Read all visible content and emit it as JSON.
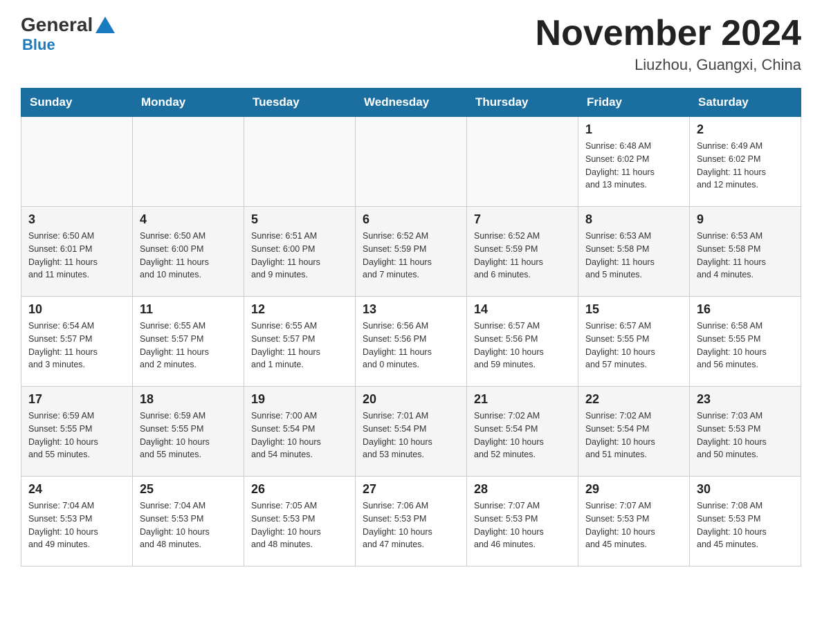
{
  "header": {
    "logo_general": "General",
    "logo_blue": "Blue",
    "month_title": "November 2024",
    "location": "Liuzhou, Guangxi, China"
  },
  "days_of_week": [
    "Sunday",
    "Monday",
    "Tuesday",
    "Wednesday",
    "Thursday",
    "Friday",
    "Saturday"
  ],
  "weeks": [
    [
      {
        "day": "",
        "info": ""
      },
      {
        "day": "",
        "info": ""
      },
      {
        "day": "",
        "info": ""
      },
      {
        "day": "",
        "info": ""
      },
      {
        "day": "",
        "info": ""
      },
      {
        "day": "1",
        "info": "Sunrise: 6:48 AM\nSunset: 6:02 PM\nDaylight: 11 hours\nand 13 minutes."
      },
      {
        "day": "2",
        "info": "Sunrise: 6:49 AM\nSunset: 6:02 PM\nDaylight: 11 hours\nand 12 minutes."
      }
    ],
    [
      {
        "day": "3",
        "info": "Sunrise: 6:50 AM\nSunset: 6:01 PM\nDaylight: 11 hours\nand 11 minutes."
      },
      {
        "day": "4",
        "info": "Sunrise: 6:50 AM\nSunset: 6:00 PM\nDaylight: 11 hours\nand 10 minutes."
      },
      {
        "day": "5",
        "info": "Sunrise: 6:51 AM\nSunset: 6:00 PM\nDaylight: 11 hours\nand 9 minutes."
      },
      {
        "day": "6",
        "info": "Sunrise: 6:52 AM\nSunset: 5:59 PM\nDaylight: 11 hours\nand 7 minutes."
      },
      {
        "day": "7",
        "info": "Sunrise: 6:52 AM\nSunset: 5:59 PM\nDaylight: 11 hours\nand 6 minutes."
      },
      {
        "day": "8",
        "info": "Sunrise: 6:53 AM\nSunset: 5:58 PM\nDaylight: 11 hours\nand 5 minutes."
      },
      {
        "day": "9",
        "info": "Sunrise: 6:53 AM\nSunset: 5:58 PM\nDaylight: 11 hours\nand 4 minutes."
      }
    ],
    [
      {
        "day": "10",
        "info": "Sunrise: 6:54 AM\nSunset: 5:57 PM\nDaylight: 11 hours\nand 3 minutes."
      },
      {
        "day": "11",
        "info": "Sunrise: 6:55 AM\nSunset: 5:57 PM\nDaylight: 11 hours\nand 2 minutes."
      },
      {
        "day": "12",
        "info": "Sunrise: 6:55 AM\nSunset: 5:57 PM\nDaylight: 11 hours\nand 1 minute."
      },
      {
        "day": "13",
        "info": "Sunrise: 6:56 AM\nSunset: 5:56 PM\nDaylight: 11 hours\nand 0 minutes."
      },
      {
        "day": "14",
        "info": "Sunrise: 6:57 AM\nSunset: 5:56 PM\nDaylight: 10 hours\nand 59 minutes."
      },
      {
        "day": "15",
        "info": "Sunrise: 6:57 AM\nSunset: 5:55 PM\nDaylight: 10 hours\nand 57 minutes."
      },
      {
        "day": "16",
        "info": "Sunrise: 6:58 AM\nSunset: 5:55 PM\nDaylight: 10 hours\nand 56 minutes."
      }
    ],
    [
      {
        "day": "17",
        "info": "Sunrise: 6:59 AM\nSunset: 5:55 PM\nDaylight: 10 hours\nand 55 minutes."
      },
      {
        "day": "18",
        "info": "Sunrise: 6:59 AM\nSunset: 5:55 PM\nDaylight: 10 hours\nand 55 minutes."
      },
      {
        "day": "19",
        "info": "Sunrise: 7:00 AM\nSunset: 5:54 PM\nDaylight: 10 hours\nand 54 minutes."
      },
      {
        "day": "20",
        "info": "Sunrise: 7:01 AM\nSunset: 5:54 PM\nDaylight: 10 hours\nand 53 minutes."
      },
      {
        "day": "21",
        "info": "Sunrise: 7:02 AM\nSunset: 5:54 PM\nDaylight: 10 hours\nand 52 minutes."
      },
      {
        "day": "22",
        "info": "Sunrise: 7:02 AM\nSunset: 5:54 PM\nDaylight: 10 hours\nand 51 minutes."
      },
      {
        "day": "23",
        "info": "Sunrise: 7:03 AM\nSunset: 5:53 PM\nDaylight: 10 hours\nand 50 minutes."
      }
    ],
    [
      {
        "day": "24",
        "info": "Sunrise: 7:04 AM\nSunset: 5:53 PM\nDaylight: 10 hours\nand 49 minutes."
      },
      {
        "day": "25",
        "info": "Sunrise: 7:04 AM\nSunset: 5:53 PM\nDaylight: 10 hours\nand 48 minutes."
      },
      {
        "day": "26",
        "info": "Sunrise: 7:05 AM\nSunset: 5:53 PM\nDaylight: 10 hours\nand 48 minutes."
      },
      {
        "day": "27",
        "info": "Sunrise: 7:06 AM\nSunset: 5:53 PM\nDaylight: 10 hours\nand 47 minutes."
      },
      {
        "day": "28",
        "info": "Sunrise: 7:07 AM\nSunset: 5:53 PM\nDaylight: 10 hours\nand 46 minutes."
      },
      {
        "day": "29",
        "info": "Sunrise: 7:07 AM\nSunset: 5:53 PM\nDaylight: 10 hours\nand 45 minutes."
      },
      {
        "day": "30",
        "info": "Sunrise: 7:08 AM\nSunset: 5:53 PM\nDaylight: 10 hours\nand 45 minutes."
      }
    ]
  ]
}
